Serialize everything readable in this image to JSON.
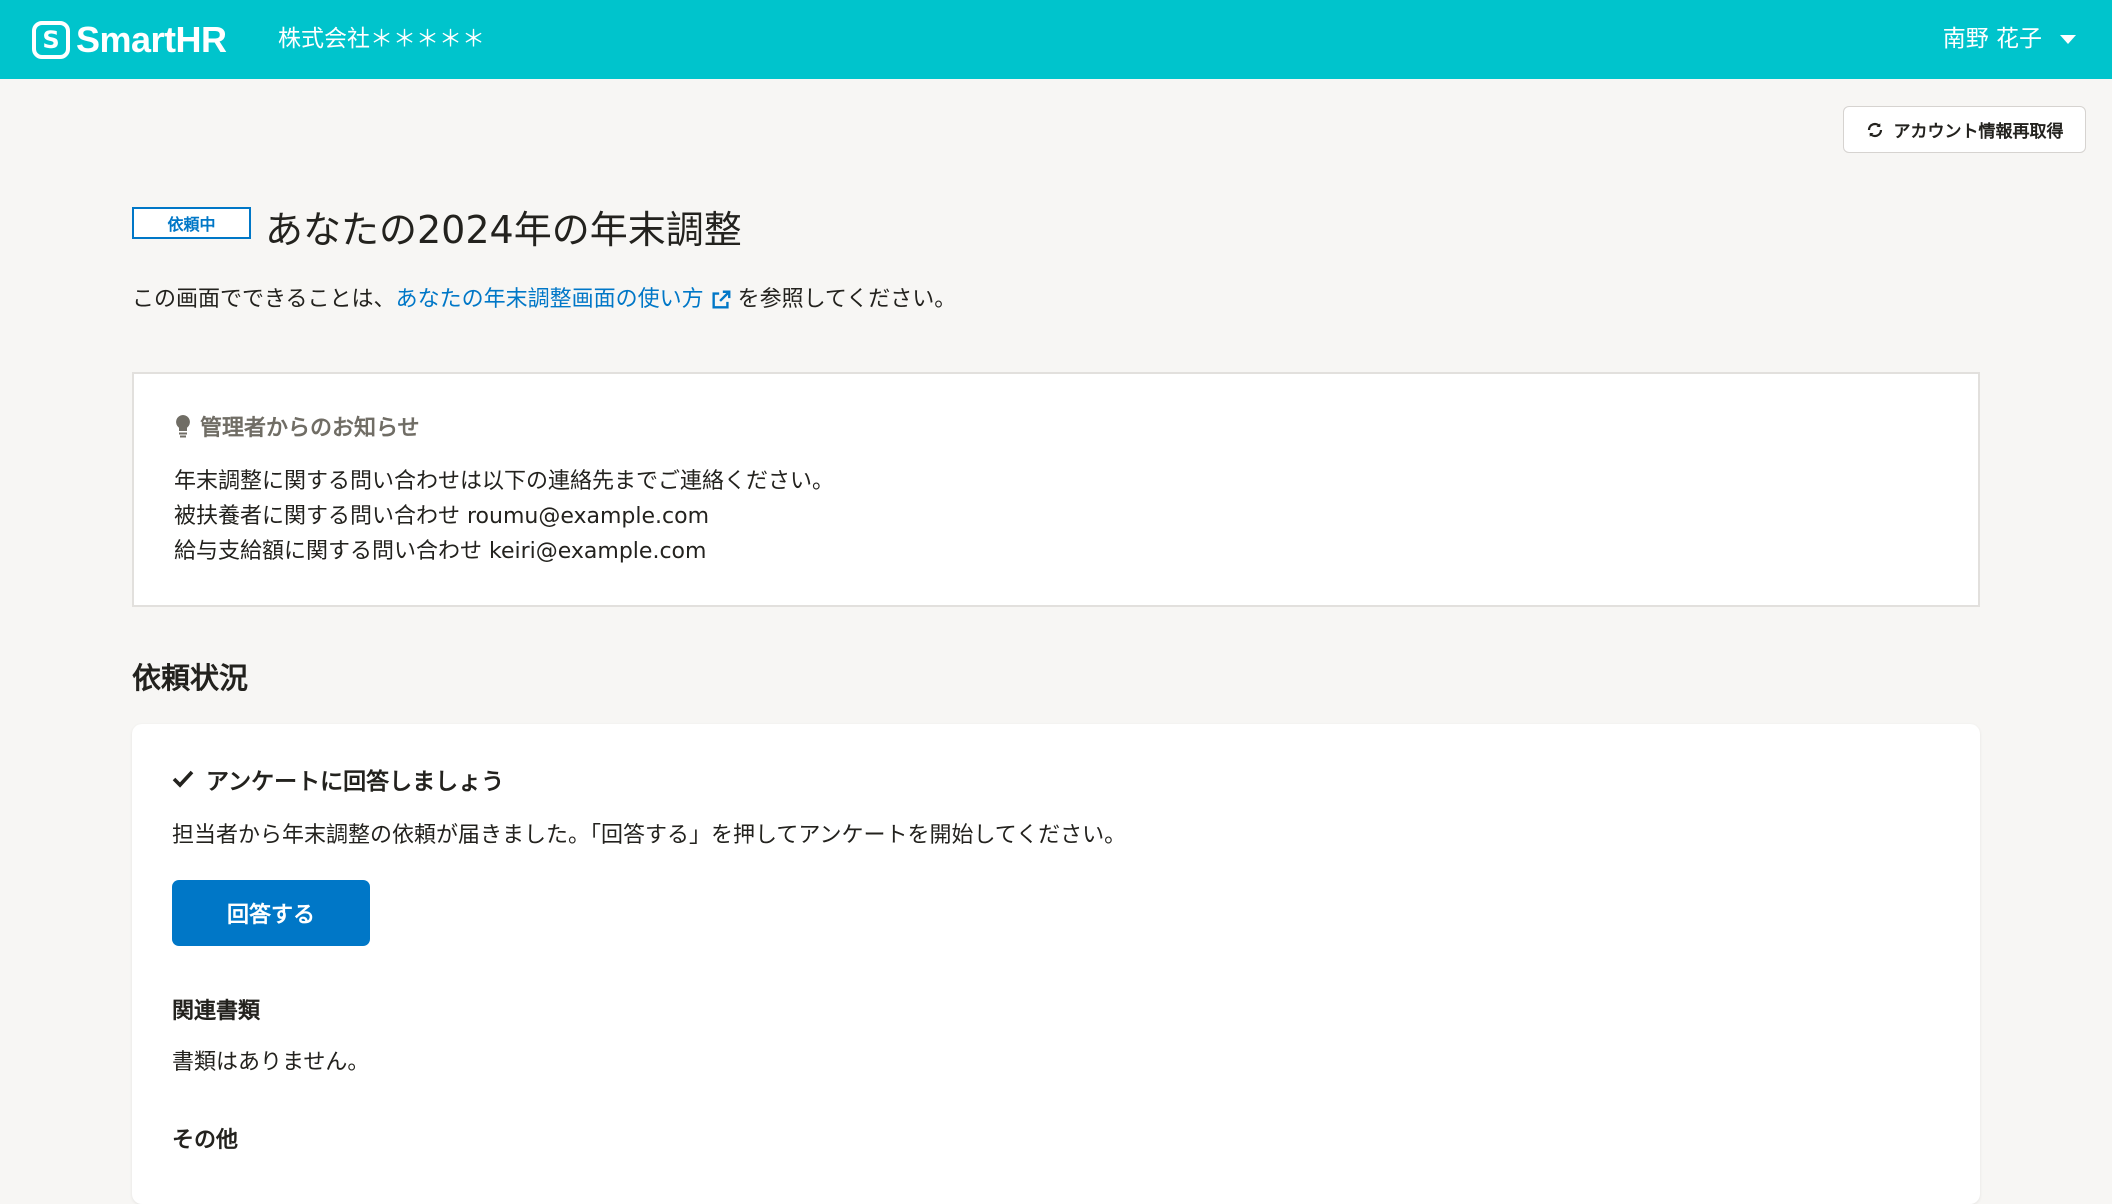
{
  "header": {
    "logo_text": "SmartHR",
    "logo_mark": "S",
    "company": "株式会社＊＊＊＊＊",
    "user_name": "南野 花子"
  },
  "toolbar": {
    "refresh_label": "アカウント情報再取得",
    "refresh_icon": "refresh-icon"
  },
  "page": {
    "status_badge": "依頼中",
    "title": "あなたの2024年の年末調整",
    "intro_before": "この画面でできることは、",
    "intro_link": "あなたの年末調整画面の使い方",
    "intro_after": "を参照してください。"
  },
  "notice": {
    "heading": "管理者からのお知らせ",
    "lines": [
      "年末調整に関する問い合わせは以下の連絡先までご連絡ください。",
      "被扶養者に関する問い合わせ roumu@example.com",
      "給与支給額に関する問い合わせ keiri@example.com"
    ]
  },
  "status_section": {
    "title": "依頼状況",
    "task_title": "アンケートに回答しましょう",
    "task_desc": "担当者から年末調整の依頼が届きました。「回答する」を押してアンケートを開始してください。",
    "answer_button": "回答する",
    "related_heading": "関連書類",
    "related_text": "書類はありません。",
    "other_heading": "その他"
  },
  "colors": {
    "header_bg": "#00c4cc",
    "primary": "#0077c7",
    "page_bg": "#f7f6f4"
  }
}
